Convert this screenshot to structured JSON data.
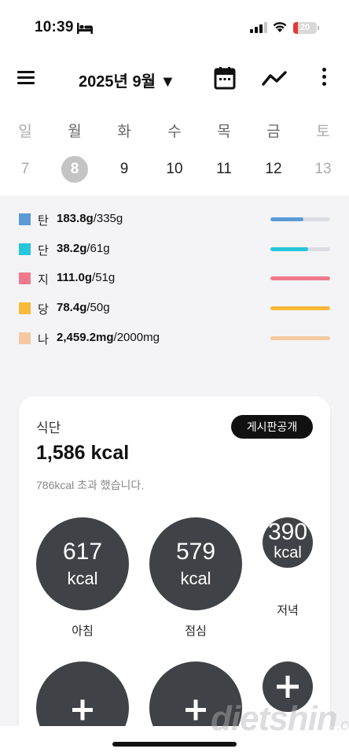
{
  "status": {
    "time": "10:39",
    "battery_level": "20",
    "battery_fraction": 0.2,
    "battery_color": "#e53935"
  },
  "header": {
    "month": "2025년 9월 ▼",
    "icons": [
      "menu-icon",
      "calendar-icon",
      "trend-icon",
      "more-icon"
    ]
  },
  "week": {
    "days": [
      "일",
      "월",
      "화",
      "수",
      "목",
      "금",
      "토"
    ],
    "dates": [
      "7",
      "8",
      "9",
      "10",
      "11",
      "12",
      "13"
    ],
    "selected_index": 1
  },
  "nutrients": [
    {
      "name": "탄",
      "value": "183.8g",
      "goal": "/335g",
      "color": "#5b9bd5",
      "fraction": 0.55
    },
    {
      "name": "단",
      "value": "38.2g",
      "goal": "/61g",
      "color": "#26c6da",
      "fraction": 0.63
    },
    {
      "name": "지",
      "value": "111.0g",
      "goal": "/51g",
      "color": "#f07a8c",
      "fraction": 1.0
    },
    {
      "name": "당",
      "value": "78.4g",
      "goal": "/50g",
      "color": "#f9b93a",
      "fraction": 1.0
    },
    {
      "name": "나",
      "value": "2,459.2mg",
      "goal": "/2000mg",
      "color": "#f5c9a0",
      "fraction": 1.0
    }
  ],
  "diet": {
    "title": "식단",
    "share_button": "게시판공개",
    "total": "1,586 kcal",
    "over_message": "786kcal 초과 했습니다.",
    "meals": [
      {
        "kcal": "617",
        "unit": "kcal",
        "label": "아침"
      },
      {
        "kcal": "579",
        "unit": "kcal",
        "label": "점심"
      },
      {
        "kcal": "390",
        "unit": "kcal",
        "label": "저녁"
      }
    ],
    "add_icon": "plus-icon"
  },
  "watermark": {
    "main": "dietshin",
    "suffix": ".com"
  }
}
